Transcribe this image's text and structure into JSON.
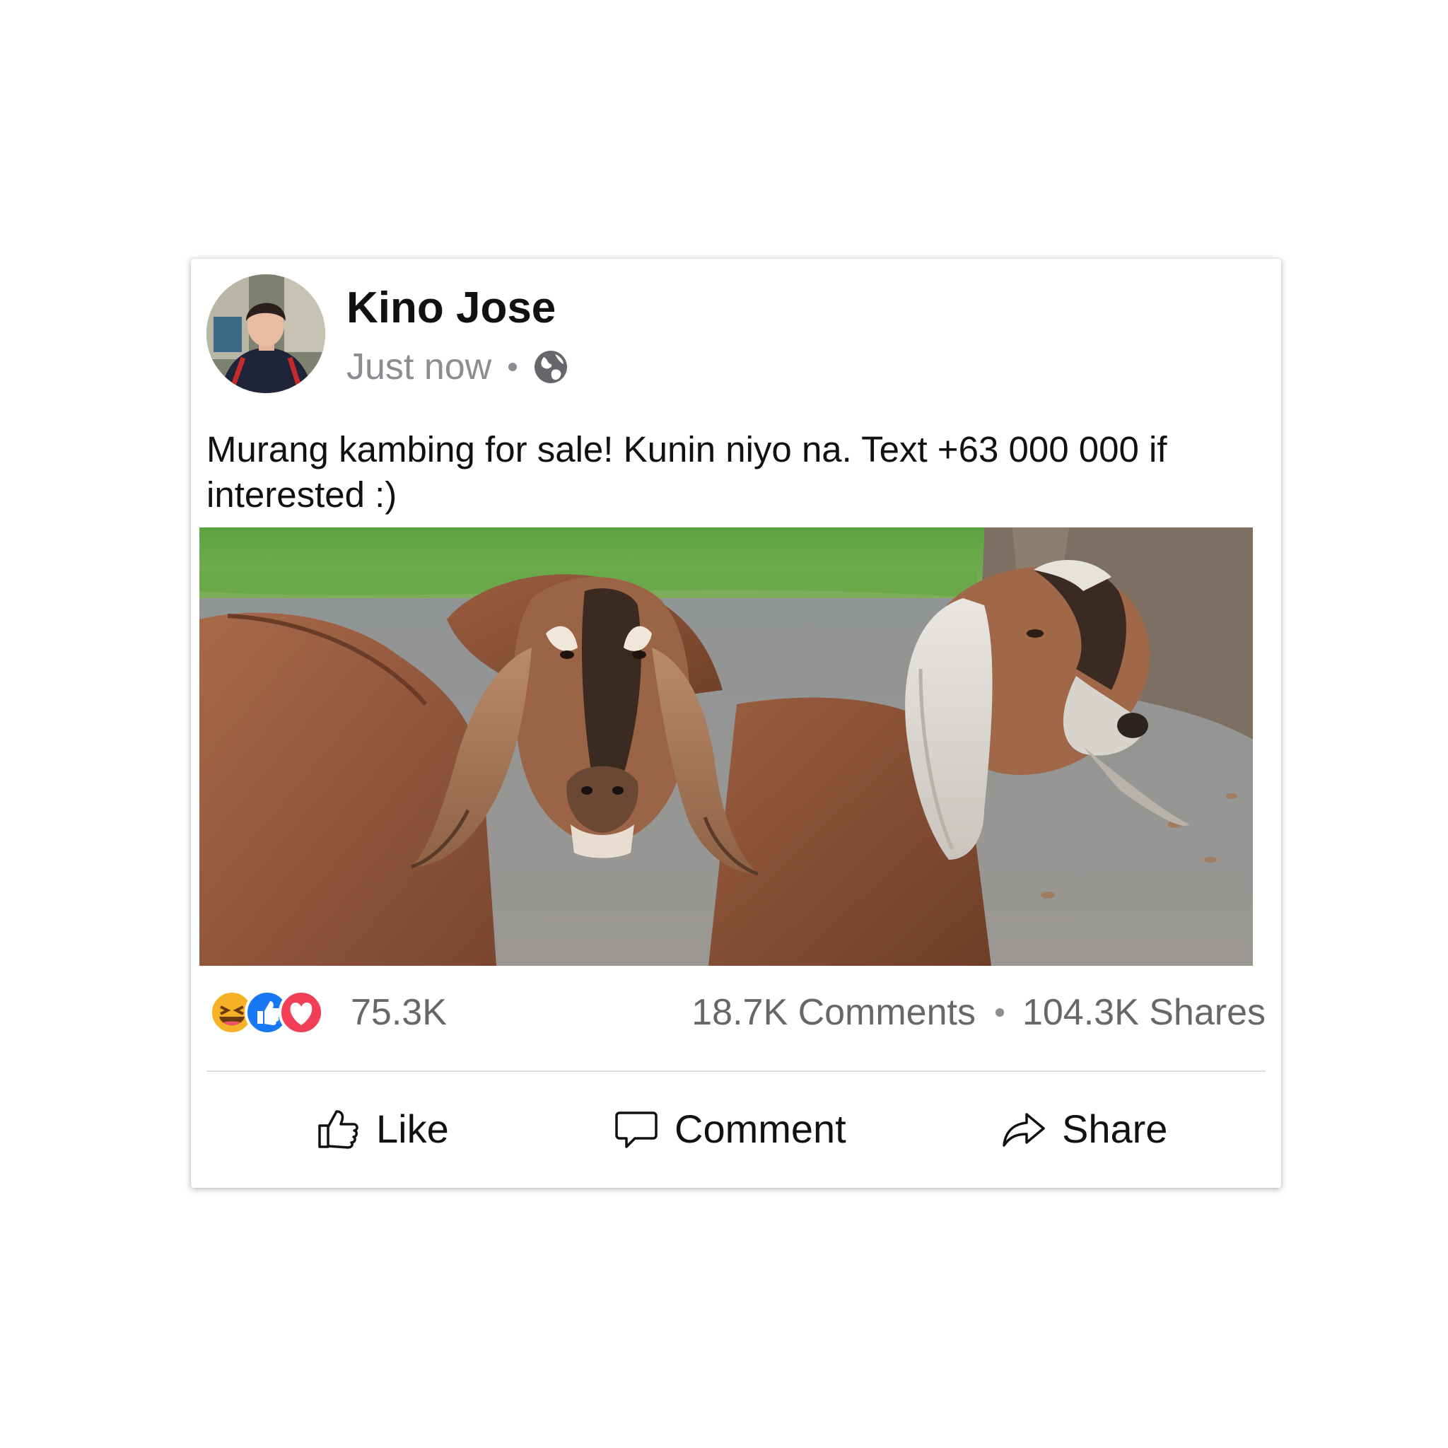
{
  "post": {
    "author": "Kino Jose",
    "timestamp": "Just now",
    "privacy_icon": "globe-icon",
    "text": "Murang kambing for sale! Kunin niyo na. Text +63 000 000 if interested :)",
    "photo_subject": "goats-photo"
  },
  "stats": {
    "reaction_icons": [
      "haha-icon",
      "like-icon",
      "love-icon"
    ],
    "reaction_count": "75.3K",
    "comments": "18.7K Comments",
    "shares": "104.3K Shares"
  },
  "actions": {
    "like_label": "Like",
    "comment_label": "Comment",
    "share_label": "Share"
  },
  "colors": {
    "like_blue": "#1877f2",
    "love_red": "#f33e58",
    "haha_yellow": "#f7b125",
    "muted_text": "#65676b"
  }
}
